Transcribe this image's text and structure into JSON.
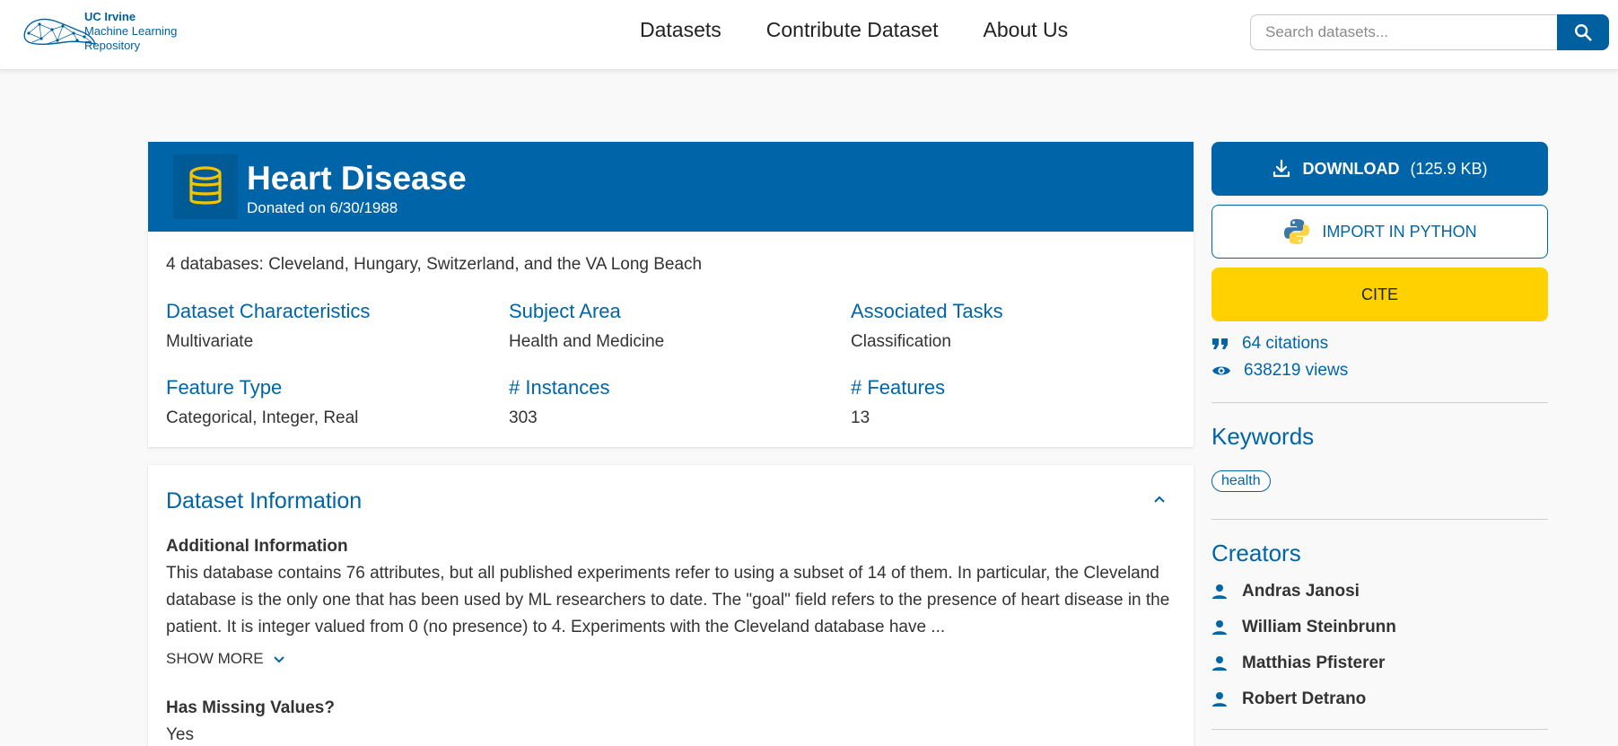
{
  "header": {
    "logo_lines": [
      "UC Irvine",
      "Machine Learning",
      "Repository"
    ],
    "nav": [
      "Datasets",
      "Contribute Dataset",
      "About Us"
    ],
    "search_placeholder": "Search datasets..."
  },
  "dataset": {
    "title": "Heart Disease",
    "donated": "Donated on 6/30/1988",
    "description": "4 databases: Cleveland, Hungary, Switzerland, and the VA Long Beach",
    "characteristics": [
      {
        "label": "Dataset Characteristics",
        "value": "Multivariate"
      },
      {
        "label": "Subject Area",
        "value": "Health and Medicine"
      },
      {
        "label": "Associated Tasks",
        "value": "Classification"
      },
      {
        "label": "Feature Type",
        "value": "Categorical, Integer, Real"
      },
      {
        "label": "# Instances",
        "value": "303"
      },
      {
        "label": "# Features",
        "value": "13"
      }
    ]
  },
  "info": {
    "title": "Dataset Information",
    "additional_heading": "Additional Information",
    "additional_text": "This database contains 76 attributes, but all published experiments refer to using a subset of 14 of them.  In particular, the Cleveland database is the only one that has been used by ML researchers to date.  The \"goal\" field refers to the presence of heart disease in the patient.  It is integer valued from 0 (no presence) to 4. Experiments with the Cleveland database have ...",
    "show_more": "SHOW MORE",
    "missing_heading": "Has Missing Values?",
    "missing_value": "Yes"
  },
  "sidebar": {
    "download_label": "DOWNLOAD",
    "download_size": "(125.9 KB)",
    "python_label": "IMPORT IN PYTHON",
    "cite_label": "CITE",
    "citations": "64 citations",
    "views": "638219 views",
    "keywords_heading": "Keywords",
    "keywords": [
      "health"
    ],
    "creators_heading": "Creators",
    "creators": [
      "Andras Janosi",
      "William Steinbrunn",
      "Matthias Pfisterer",
      "Robert Detrano"
    ]
  },
  "colors": {
    "brand_blue": "#0065a8",
    "cite_yellow": "#ffd100",
    "db_icon_yellow": "#f5c400"
  }
}
